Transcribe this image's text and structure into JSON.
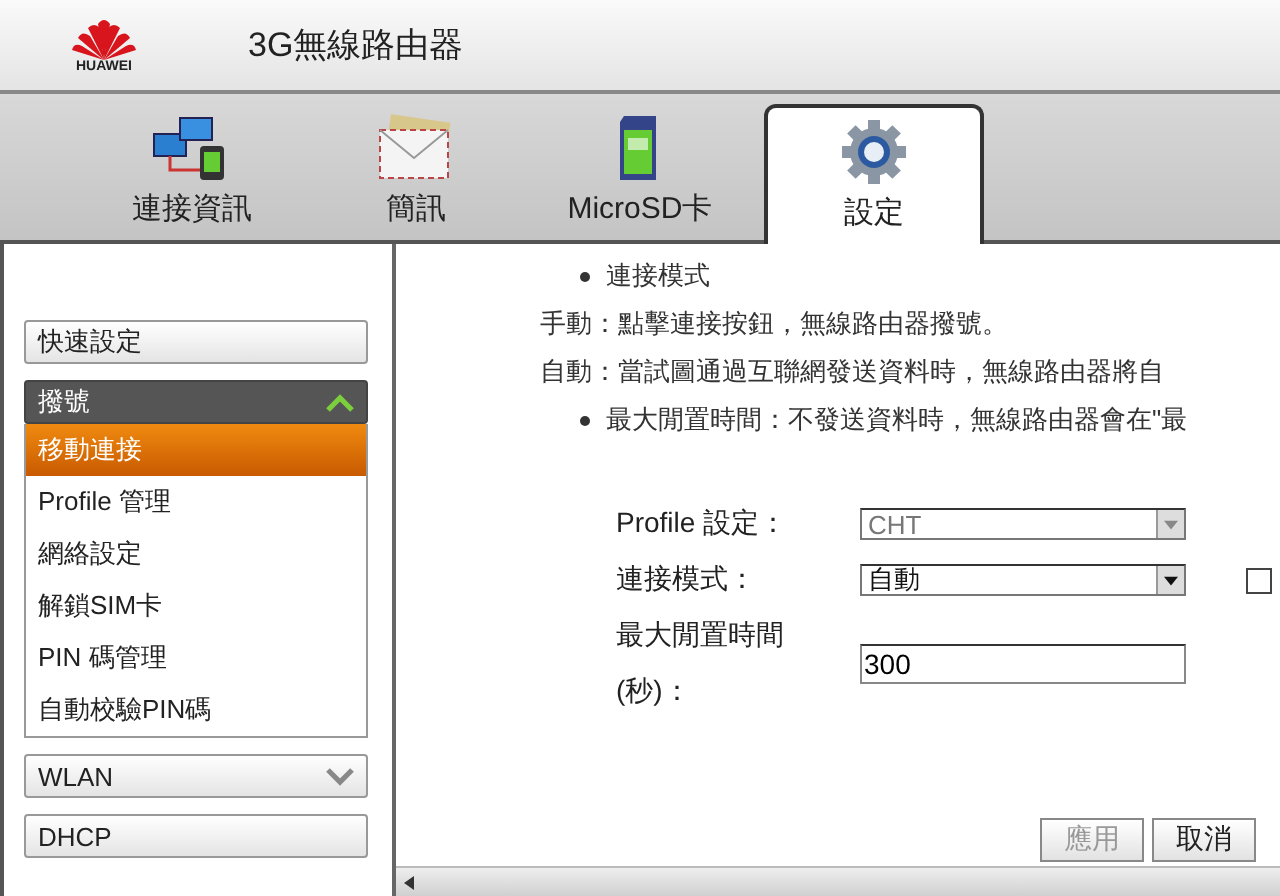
{
  "header": {
    "logo_text": "HUAWEI",
    "title": "3G無線路由器"
  },
  "tabs": [
    {
      "label": "連接資訊",
      "selected": false
    },
    {
      "label": "簡訊",
      "selected": false
    },
    {
      "label": "MicroSD卡",
      "selected": false
    },
    {
      "label": "設定",
      "selected": true
    }
  ],
  "sidebar": {
    "items": [
      {
        "kind": "button",
        "label": "快速設定"
      },
      {
        "kind": "group",
        "label": "撥號",
        "expanded": true,
        "children": [
          {
            "label": "移動連接",
            "selected": true
          },
          {
            "label": "Profile 管理",
            "selected": false
          },
          {
            "label": "網絡設定",
            "selected": false
          },
          {
            "label": "解鎖SIM卡",
            "selected": false
          },
          {
            "label": "PIN 碼管理",
            "selected": false
          },
          {
            "label": "自動校驗PIN碼",
            "selected": false
          }
        ]
      },
      {
        "kind": "group",
        "label": "WLAN",
        "expanded": false
      },
      {
        "kind": "button",
        "label": "DHCP"
      }
    ]
  },
  "help": [
    {
      "kind": "bullet",
      "text": "連接模式"
    },
    {
      "kind": "plain",
      "text": "手動：點擊連接按鈕，無線路由器撥號。"
    },
    {
      "kind": "plain",
      "text": "自動：當試圖通過互聯網發送資料時，無線路由器將自"
    },
    {
      "kind": "bullet",
      "text": "最大閒置時間：不發送資料時，無線路由器會在\"最"
    }
  ],
  "form": [
    {
      "kind": "select",
      "label": "Profile 設定：",
      "value": "CHT",
      "disabled": true
    },
    {
      "kind": "select",
      "label": "連接模式：",
      "value": "自動",
      "disabled": false,
      "checkbox": {
        "checked": false
      }
    },
    {
      "kind": "input",
      "label_lines": [
        "最大閒置時間",
        "(秒)："
      ],
      "value": "300"
    }
  ],
  "buttons": [
    {
      "label": "應用",
      "disabled": true
    },
    {
      "label": "取消",
      "disabled": false
    }
  ]
}
